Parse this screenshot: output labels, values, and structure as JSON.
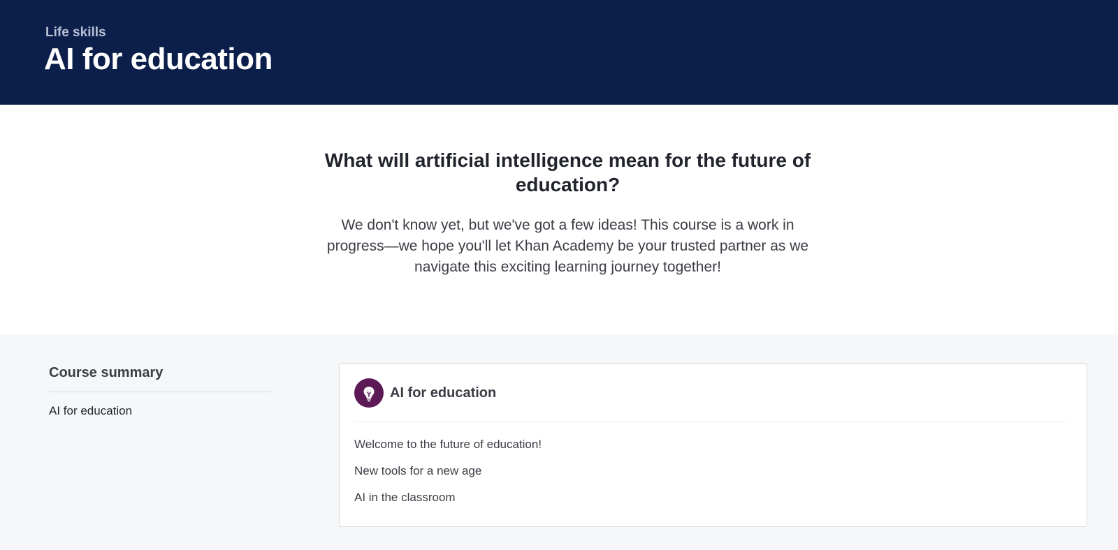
{
  "header": {
    "breadcrumb": "Life skills",
    "title": "AI for education",
    "background_color": "#0c1f4a"
  },
  "intro": {
    "heading": "What will artificial intelligence mean for the future of education?",
    "body": "We don't know yet, but we've got a few ideas! This course is a work in progress—we hope you'll let Khan Academy be your trusted partner as we navigate this exciting learning journey together!"
  },
  "summary": {
    "title": "Course summary",
    "items": [
      {
        "label": "AI for education"
      }
    ]
  },
  "unit": {
    "title": "AI for education",
    "icon": "lightbulb-icon",
    "icon_color": "#5b1a55",
    "lessons": [
      {
        "label": "Welcome to the future of education!"
      },
      {
        "label": "New tools for a new age"
      },
      {
        "label": "AI in the classroom"
      }
    ]
  }
}
